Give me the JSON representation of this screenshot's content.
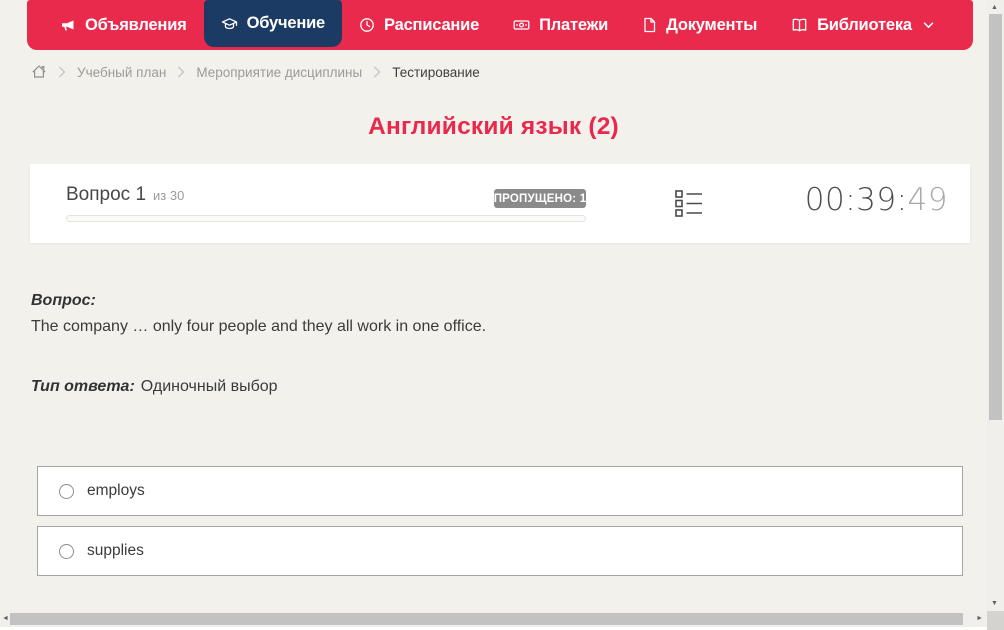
{
  "navbar": {
    "items": [
      {
        "label": "Объявления",
        "icon": "megaphone-icon",
        "active": false
      },
      {
        "label": "Обучение",
        "icon": "graduation-cap-icon",
        "active": true
      },
      {
        "label": "Расписание",
        "icon": "clock-icon",
        "active": false
      },
      {
        "label": "Платежи",
        "icon": "banknote-icon",
        "active": false
      },
      {
        "label": "Документы",
        "icon": "document-icon",
        "active": false
      },
      {
        "label": "Библиотека",
        "icon": "open-book-icon",
        "active": false,
        "has_dropdown": true
      }
    ],
    "colors": {
      "bar": "#e92a4d",
      "active_item": "#1b3a64"
    }
  },
  "breadcrumb": {
    "home_icon": "home-icon",
    "items": [
      "Учебный план",
      "Мероприятие дисциплины",
      "Тестирование"
    ]
  },
  "page": {
    "title": "Английский язык (2)",
    "title_color": "#e9284c",
    "background_color": "#f2f1ec"
  },
  "question_card": {
    "question_label": "Вопрос 1",
    "question_total": "из 30",
    "skipped_badge": "ПРОПУЩЕНО: 1",
    "progress_percent": 0,
    "list_icon": "question-list-icon",
    "timer": {
      "main": "00:39:",
      "seconds": "49"
    }
  },
  "question": {
    "label": "Вопрос:",
    "text": "The company … only four people and they all work in one office.",
    "answer_type_label": "Тип ответа:",
    "answer_type_value": "Одиночный выбор",
    "options": [
      {
        "label": "employs",
        "selected": false
      },
      {
        "label": "supplies",
        "selected": false
      }
    ]
  },
  "scrollbars": {
    "vertical_arrows": [
      "▲",
      "▼"
    ],
    "horizontal_arrows": [
      "◄",
      "►"
    ]
  }
}
